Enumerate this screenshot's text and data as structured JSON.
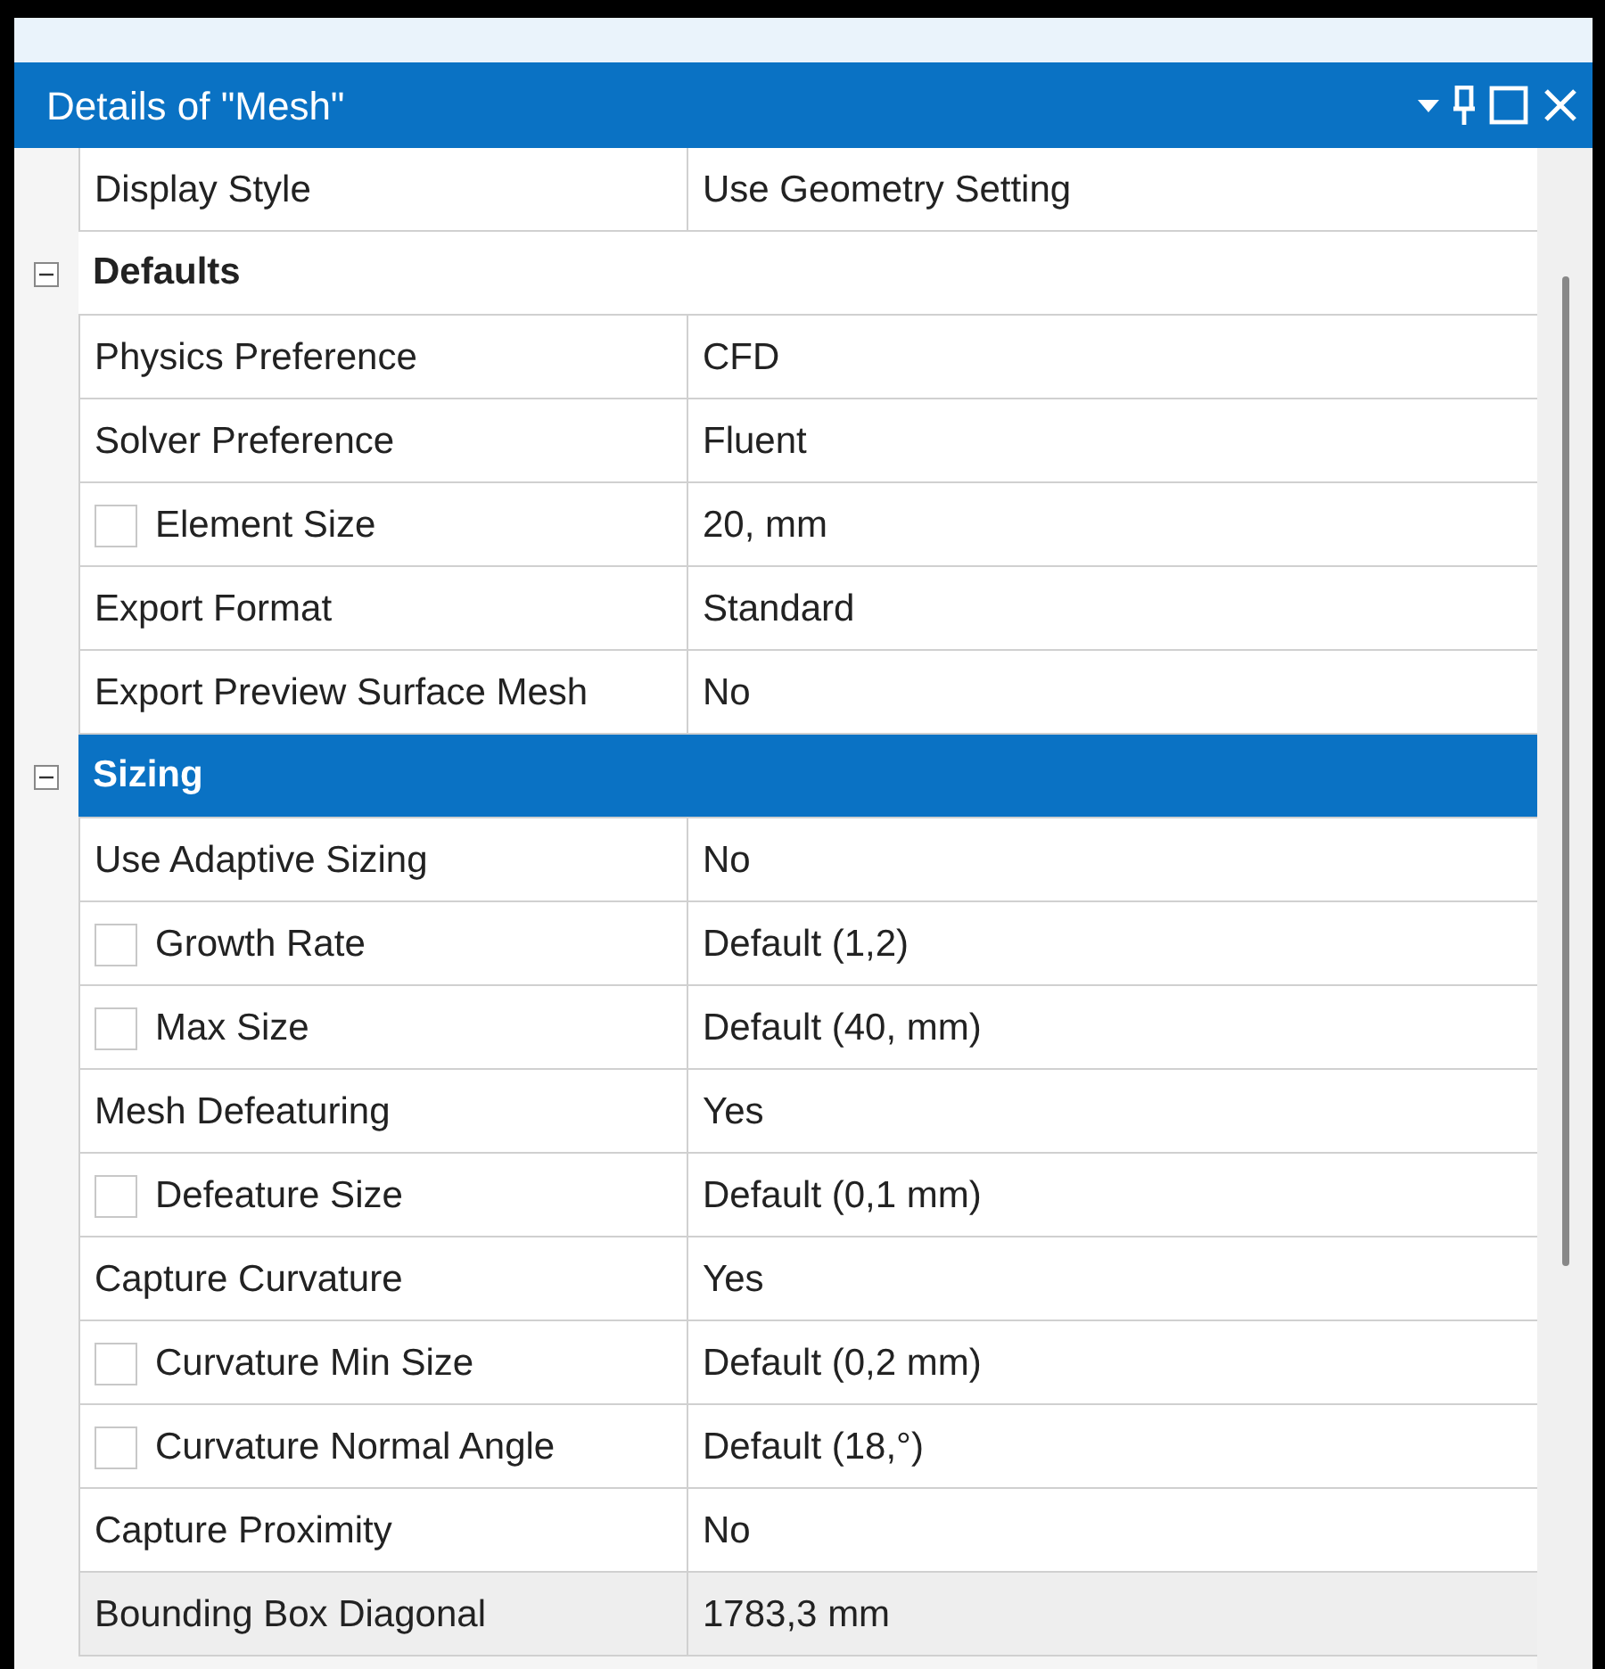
{
  "window": {
    "title": "Details of \"Mesh\""
  },
  "rows": [
    {
      "kind": "property",
      "label": "Display Style",
      "value": "Use Geometry Setting"
    },
    {
      "kind": "group",
      "label": "Defaults",
      "expanded": true,
      "selected": false
    },
    {
      "kind": "property",
      "label": "Physics Preference",
      "value": "CFD"
    },
    {
      "kind": "property",
      "label": "Solver Preference",
      "value": "Fluent"
    },
    {
      "kind": "checkbox",
      "label": "Element Size",
      "value": "20, mm",
      "checked": false
    },
    {
      "kind": "property",
      "label": "Export Format",
      "value": "Standard"
    },
    {
      "kind": "property",
      "label": "Export Preview Surface Mesh",
      "value": "No"
    },
    {
      "kind": "group",
      "label": "Sizing",
      "expanded": true,
      "selected": true
    },
    {
      "kind": "property",
      "label": "Use Adaptive Sizing",
      "value": "No"
    },
    {
      "kind": "checkbox",
      "label": "Growth Rate",
      "value": "Default (1,2)",
      "checked": false
    },
    {
      "kind": "checkbox",
      "label": "Max Size",
      "value": "Default (40, mm)",
      "checked": false
    },
    {
      "kind": "property",
      "label": "Mesh Defeaturing",
      "value": "Yes"
    },
    {
      "kind": "checkbox",
      "label": "Defeature Size",
      "value": "Default (0,1 mm)",
      "checked": false
    },
    {
      "kind": "property",
      "label": "Capture Curvature",
      "value": "Yes"
    },
    {
      "kind": "checkbox",
      "label": "Curvature Min Size",
      "value": "Default (0,2 mm)",
      "checked": false
    },
    {
      "kind": "checkbox",
      "label": "Curvature Normal Angle",
      "value": "Default (18,°)",
      "checked": false
    },
    {
      "kind": "property",
      "label": "Capture Proximity",
      "value": "No"
    },
    {
      "kind": "readonly",
      "label": "Bounding Box Diagonal",
      "value": "1783,3 mm"
    }
  ]
}
